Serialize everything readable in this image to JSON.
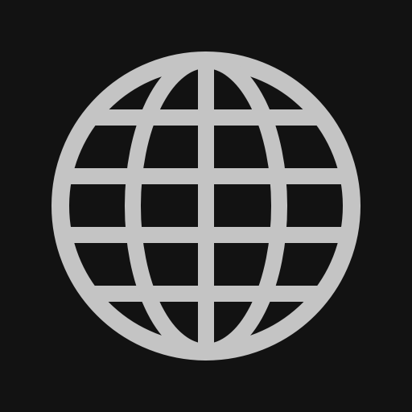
{
  "icon": {
    "name": "globe-icon",
    "background_color": "#121212",
    "glyph_color": "#C4C4C4"
  }
}
